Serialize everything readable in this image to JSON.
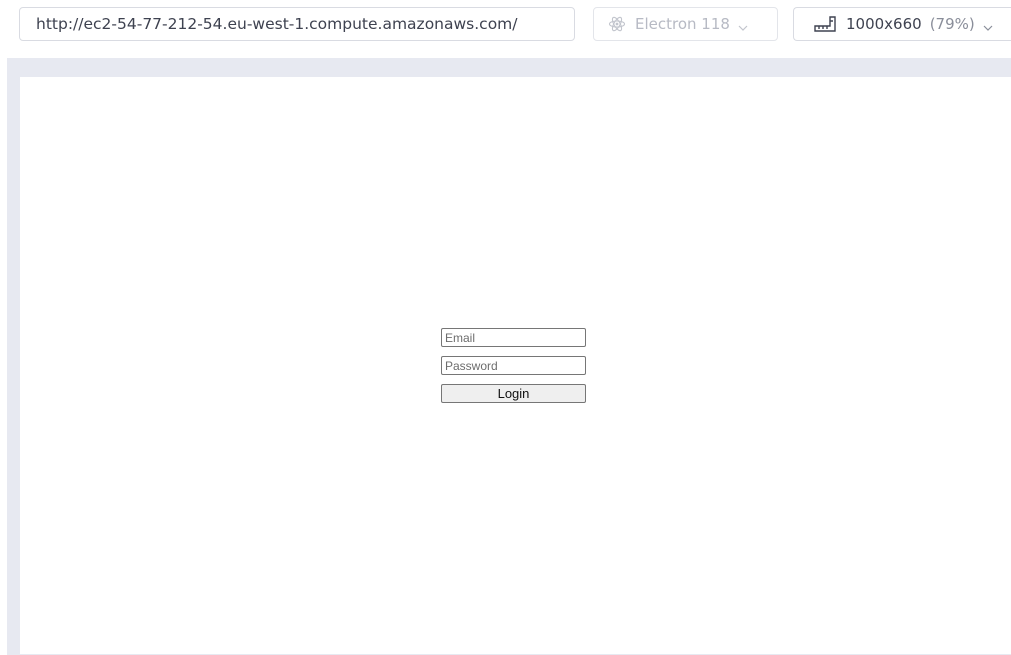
{
  "toolbar": {
    "url": "http://ec2-54-77-212-54.eu-west-1.compute.amazonaws.com/",
    "browser_label": "Electron 118",
    "browser_icon": "electron-atom-icon",
    "viewport_size": "1000x660",
    "viewport_scale": "(79%)",
    "viewport_icon": "ruler-icon"
  },
  "login": {
    "email_placeholder": "Email",
    "password_placeholder": "Password",
    "login_label": "Login"
  },
  "colors": {
    "stage_background": "#e7e9f1",
    "field_border": "#767676",
    "button_background": "#efefef"
  }
}
